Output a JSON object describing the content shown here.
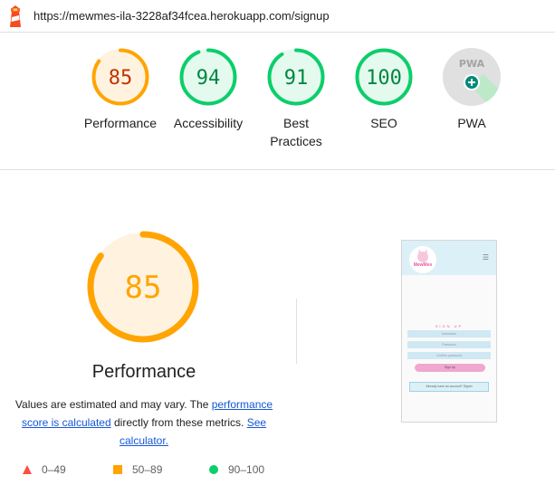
{
  "url": "https://mewmes-ila-3228af34fcea.herokuapp.com/signup",
  "colors": {
    "orange": "#ffa400",
    "orange_bg": "#fff3e0",
    "orange_text": "#c33300",
    "green": "#0cce6b",
    "green_bg": "#e5faef",
    "green_text": "#018642",
    "grey": "#757575",
    "red": "#ff4e42"
  },
  "gauges": [
    {
      "score": "85",
      "value": 85,
      "label": "Performance",
      "status": "average"
    },
    {
      "score": "94",
      "value": 94,
      "label": "Accessibility",
      "status": "pass"
    },
    {
      "score": "91",
      "value": 91,
      "label": "Best Practices",
      "status": "pass"
    },
    {
      "score": "100",
      "value": 100,
      "label": "SEO",
      "status": "pass"
    },
    {
      "score": "",
      "value": null,
      "label": "PWA",
      "status": "pwa",
      "badge": "PWA"
    }
  ],
  "main": {
    "score": "85",
    "value": 85,
    "title": "Performance",
    "note_prefix": "Values are estimated and may vary. The ",
    "note_link1": "performance score is calculated",
    "note_middle": " directly from these metrics. ",
    "note_link2": "See calculator."
  },
  "legend": [
    {
      "range": "0–49",
      "shape": "triangle",
      "color": "#ff4e42"
    },
    {
      "range": "50–89",
      "shape": "square",
      "color": "#ffa400"
    },
    {
      "range": "90–100",
      "shape": "circle",
      "color": "#0cce6b"
    }
  ],
  "screenshot": {
    "brand": "MewMes",
    "menu": "☰",
    "heading": "SIGN UP",
    "fields": [
      "Username",
      "Password",
      "Confirm password"
    ],
    "button": "Sign Up",
    "footer": "Already have an account? Signin"
  }
}
